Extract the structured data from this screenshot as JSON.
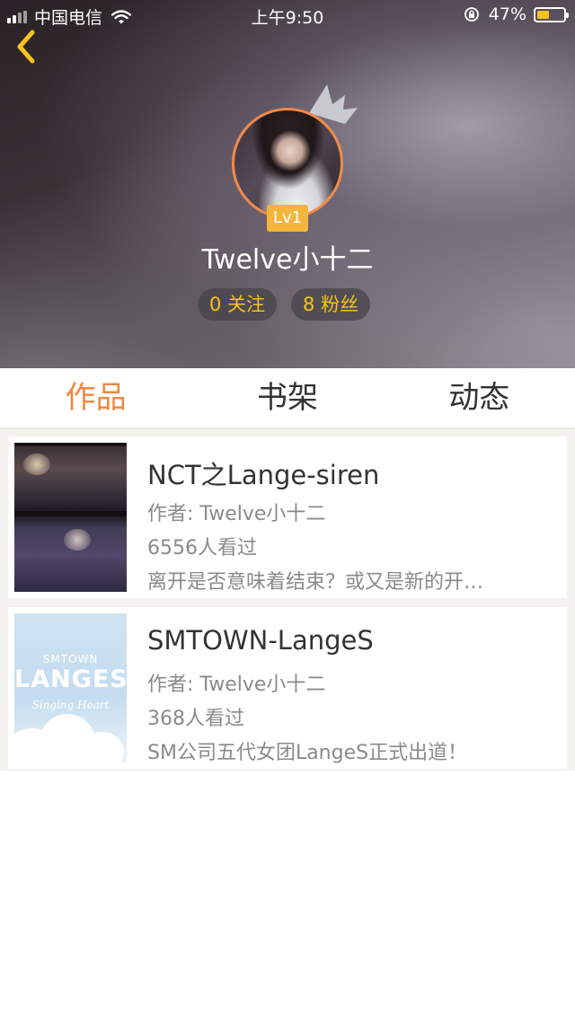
{
  "status_bar": {
    "carrier": "中国电信",
    "time": "上午9:50",
    "battery_percent": "47%",
    "battery_level": 0.47
  },
  "profile": {
    "level": "Lv1",
    "username": "Twelve小十二",
    "following": "0 关注",
    "followers": "8 粉丝"
  },
  "tabs": [
    {
      "label": "作品",
      "active": true
    },
    {
      "label": "书架",
      "active": false
    },
    {
      "label": "动态",
      "active": false
    }
  ],
  "works": [
    {
      "title": "NCT之Lange-siren",
      "author": "作者: Twelve小十二",
      "views": "6556人看过",
      "description": "离开是否意味着结束？或又是新的开…"
    },
    {
      "title": "SMTOWN-LangeS",
      "author": "作者: Twelve小十二",
      "views": "368人看过",
      "description": "SM公司五代女团LangeS正式出道！",
      "cover": {
        "top_text": "SMTOWN",
        "main_text": "LANGES",
        "script_text": "Singing Heart"
      }
    }
  ],
  "colors": {
    "accent": "#ef8741",
    "gold": "#f5c31b",
    "level_badge": "#f5b53d"
  }
}
